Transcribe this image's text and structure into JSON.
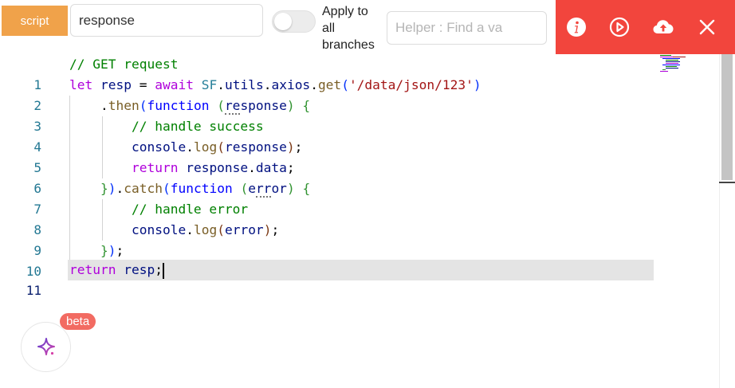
{
  "toolbar": {
    "script_tab": "script",
    "name_value": "response",
    "apply_label": "Apply to all branches",
    "apply_toggle_on": false,
    "helper_placeholder": "Helper : Find a va",
    "action_bar_color": "#f2453d"
  },
  "icons": [
    "info-icon",
    "play-icon",
    "upload-cloud-icon",
    "close-icon",
    "sparkle-icon"
  ],
  "editor": {
    "language": "javascript",
    "active_line": 11,
    "lines": [
      {
        "num": "1",
        "code": "// GET request"
      },
      {
        "num": "2",
        "code": "let resp = await SF.utils.axios.get('/data/json/123')"
      },
      {
        "num": "3",
        "code": "    .then(function (response) {"
      },
      {
        "num": "4",
        "code": "        // handle success"
      },
      {
        "num": "5",
        "code": "        console.log(response);"
      },
      {
        "num": "6",
        "code": "        return response.data;"
      },
      {
        "num": "7",
        "code": "    }).catch(function (error) {"
      },
      {
        "num": "8",
        "code": "        // handle error"
      },
      {
        "num": "9",
        "code": "        console.log(error);"
      },
      {
        "num": "10",
        "code": "    });"
      },
      {
        "num": "11",
        "code": "return resp;"
      }
    ]
  },
  "assistant": {
    "badge": "beta"
  }
}
